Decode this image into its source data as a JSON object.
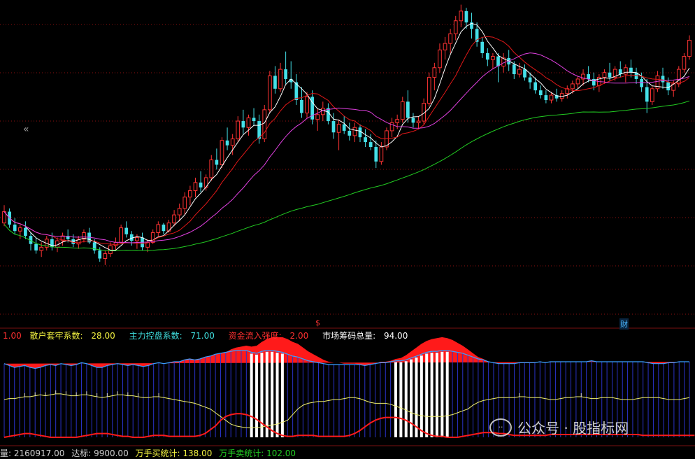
{
  "colors": {
    "up": "#ff3333",
    "down": "#44e0e8",
    "ma_white": "#ffffff",
    "ma_red": "#e01818",
    "ma_magenta": "#e040e0",
    "ma_green": "#22cc22",
    "blue_bar": "#2a33c8",
    "blue_line": "#3aa0ff",
    "yellow_line": "#f0f070",
    "red_line": "#ff1a1a",
    "grid": "#8b1010",
    "legend_white": "#ffffff",
    "legend_yellow": "#f0f040",
    "legend_cyan": "#40e0e0",
    "legend_red": "#ff3030"
  },
  "legend": {
    "first_value": "1.00",
    "item1_label": "散户套牢系数:",
    "item1_value": "28.00",
    "item2_label": "主力控盘系数:",
    "item2_value": "71.00",
    "item3_label": "资金流入强度:",
    "item3_value": "2.00",
    "item4_label": "市场筹码总量:",
    "item4_value": "94.00"
  },
  "footer": {
    "item1": "量: 2160917.00",
    "item2": "达标: 9900.00",
    "item3": "万手买统计: 138.00",
    "item4": "万手卖统计: 102.00"
  },
  "markers": {
    "s_marker": "$",
    "cai_marker": "财"
  },
  "nav": {
    "collapse_icon": "chevrons-left-icon",
    "collapse_glyph": "«"
  },
  "watermark": {
    "icon": "wechat-icon",
    "text": "公众号 · 股指标网"
  },
  "chart_data": [
    {
      "type": "candlestick",
      "ohlc": [
        [
          1.05,
          1.16,
          1.03,
          1.12
        ],
        [
          1.12,
          1.14,
          1.02,
          1.04
        ],
        [
          1.04,
          1.08,
          0.98,
          1.0
        ],
        [
          1.0,
          1.04,
          0.95,
          1.02
        ],
        [
          1.02,
          1.06,
          0.95,
          0.97
        ],
        [
          0.97,
          0.99,
          0.88,
          0.92
        ],
        [
          0.92,
          0.96,
          0.86,
          0.88
        ],
        [
          0.88,
          0.93,
          0.84,
          0.9
        ],
        [
          0.9,
          0.97,
          0.88,
          0.95
        ],
        [
          0.95,
          0.99,
          0.88,
          0.9
        ],
        [
          0.9,
          0.96,
          0.87,
          0.94
        ],
        [
          0.94,
          0.99,
          0.91,
          0.97
        ],
        [
          0.97,
          1.01,
          0.93,
          0.95
        ],
        [
          0.95,
          0.98,
          0.9,
          0.92
        ],
        [
          0.92,
          0.97,
          0.89,
          0.95
        ],
        [
          0.95,
          1.01,
          0.93,
          0.99
        ],
        [
          0.99,
          1.02,
          0.92,
          0.93
        ],
        [
          0.93,
          0.95,
          0.86,
          0.88
        ],
        [
          0.88,
          0.9,
          0.81,
          0.83
        ],
        [
          0.83,
          0.88,
          0.79,
          0.86
        ],
        [
          0.86,
          0.93,
          0.84,
          0.91
        ],
        [
          0.91,
          0.96,
          0.88,
          0.93
        ],
        [
          0.93,
          1.04,
          0.92,
          1.02
        ],
        [
          1.02,
          1.06,
          0.96,
          0.98
        ],
        [
          0.98,
          1.0,
          0.91,
          0.94
        ],
        [
          0.94,
          0.98,
          0.89,
          0.96
        ],
        [
          0.96,
          0.99,
          0.88,
          0.9
        ],
        [
          0.9,
          0.95,
          0.87,
          0.93
        ],
        [
          0.93,
          1.01,
          0.92,
          0.99
        ],
        [
          0.99,
          1.06,
          0.97,
          1.04
        ],
        [
          1.04,
          1.05,
          0.98,
          1.0
        ],
        [
          1.0,
          1.07,
          0.99,
          1.05
        ],
        [
          1.05,
          1.13,
          1.03,
          1.1
        ],
        [
          1.1,
          1.17,
          1.06,
          1.14
        ],
        [
          1.14,
          1.24,
          1.1,
          1.21
        ],
        [
          1.21,
          1.28,
          1.16,
          1.25
        ],
        [
          1.25,
          1.33,
          1.21,
          1.3
        ],
        [
          1.3,
          1.37,
          1.24,
          1.27
        ],
        [
          1.27,
          1.35,
          1.25,
          1.33
        ],
        [
          1.33,
          1.47,
          1.31,
          1.44
        ],
        [
          1.44,
          1.51,
          1.38,
          1.41
        ],
        [
          1.41,
          1.58,
          1.39,
          1.56
        ],
        [
          1.56,
          1.64,
          1.5,
          1.53
        ],
        [
          1.53,
          1.6,
          1.47,
          1.57
        ],
        [
          1.57,
          1.71,
          1.55,
          1.68
        ],
        [
          1.68,
          1.75,
          1.6,
          1.64
        ],
        [
          1.64,
          1.72,
          1.59,
          1.7
        ],
        [
          1.7,
          1.76,
          1.65,
          1.68
        ],
        [
          1.68,
          1.72,
          1.54,
          1.57
        ],
        [
          1.57,
          1.78,
          1.55,
          1.75
        ],
        [
          1.75,
          1.99,
          1.73,
          1.96
        ],
        [
          1.96,
          2.02,
          1.85,
          1.88
        ],
        [
          1.88,
          2.04,
          1.86,
          2.0
        ],
        [
          2.0,
          2.11,
          1.91,
          1.94
        ],
        [
          1.94,
          2.05,
          1.88,
          1.92
        ],
        [
          1.92,
          1.97,
          1.78,
          1.81
        ],
        [
          1.81,
          1.89,
          1.7,
          1.73
        ],
        [
          1.73,
          1.86,
          1.7,
          1.83
        ],
        [
          1.83,
          1.87,
          1.66,
          1.69
        ],
        [
          1.69,
          1.76,
          1.62,
          1.72
        ],
        [
          1.72,
          1.8,
          1.68,
          1.76
        ],
        [
          1.76,
          1.79,
          1.66,
          1.68
        ],
        [
          1.68,
          1.73,
          1.57,
          1.61
        ],
        [
          1.61,
          1.69,
          1.5,
          1.66
        ],
        [
          1.66,
          1.71,
          1.6,
          1.62
        ],
        [
          1.62,
          1.67,
          1.56,
          1.59
        ],
        [
          1.59,
          1.67,
          1.55,
          1.64
        ],
        [
          1.64,
          1.66,
          1.55,
          1.58
        ],
        [
          1.58,
          1.63,
          1.52,
          1.55
        ],
        [
          1.55,
          1.6,
          1.5,
          1.52
        ],
        [
          1.52,
          1.56,
          1.39,
          1.43
        ],
        [
          1.43,
          1.55,
          1.41,
          1.52
        ],
        [
          1.52,
          1.64,
          1.5,
          1.62
        ],
        [
          1.62,
          1.7,
          1.58,
          1.67
        ],
        [
          1.67,
          1.72,
          1.63,
          1.69
        ],
        [
          1.69,
          1.83,
          1.67,
          1.8
        ],
        [
          1.8,
          1.87,
          1.67,
          1.7
        ],
        [
          1.7,
          1.73,
          1.64,
          1.67
        ],
        [
          1.67,
          1.71,
          1.63,
          1.68
        ],
        [
          1.68,
          1.82,
          1.66,
          1.79
        ],
        [
          1.79,
          1.98,
          1.77,
          1.95
        ],
        [
          1.95,
          2.04,
          1.87,
          2.01
        ],
        [
          2.01,
          2.16,
          1.98,
          2.12
        ],
        [
          2.12,
          2.2,
          2.06,
          2.16
        ],
        [
          2.16,
          2.25,
          2.1,
          2.22
        ],
        [
          2.22,
          2.33,
          2.18,
          2.3
        ],
        [
          2.3,
          2.4,
          2.26,
          2.36
        ],
        [
          2.36,
          2.38,
          2.25,
          2.29
        ],
        [
          2.29,
          2.35,
          2.19,
          2.25
        ],
        [
          2.25,
          2.29,
          2.14,
          2.17
        ],
        [
          2.17,
          2.2,
          2.07,
          2.1
        ],
        [
          2.1,
          2.13,
          2.02,
          2.06
        ],
        [
          2.06,
          2.1,
          2.0,
          2.08
        ],
        [
          2.08,
          2.1,
          1.92,
          2.02
        ],
        [
          2.02,
          2.1,
          1.98,
          2.07
        ],
        [
          2.07,
          2.12,
          1.99,
          2.03
        ],
        [
          2.03,
          2.05,
          1.94,
          1.97
        ],
        [
          1.97,
          2.04,
          1.95,
          2.0
        ],
        [
          2.0,
          2.03,
          1.93,
          1.95
        ],
        [
          1.95,
          1.98,
          1.88,
          1.92
        ],
        [
          1.92,
          1.95,
          1.85,
          1.87
        ],
        [
          1.87,
          1.9,
          1.82,
          1.84
        ],
        [
          1.84,
          1.87,
          1.79,
          1.81
        ],
        [
          1.81,
          1.86,
          1.79,
          1.84
        ],
        [
          1.84,
          1.88,
          1.8,
          1.82
        ],
        [
          1.82,
          1.87,
          1.8,
          1.85
        ],
        [
          1.85,
          1.9,
          1.82,
          1.88
        ],
        [
          1.88,
          1.93,
          1.85,
          1.91
        ],
        [
          1.91,
          1.96,
          1.88,
          1.94
        ],
        [
          1.94,
          2.0,
          1.9,
          1.97
        ],
        [
          1.97,
          2.02,
          1.92,
          1.94
        ],
        [
          1.94,
          1.98,
          1.87,
          1.9
        ],
        [
          1.9,
          1.97,
          1.86,
          1.95
        ],
        [
          1.95,
          2.0,
          1.91,
          1.98
        ],
        [
          1.98,
          2.04,
          1.93,
          1.95
        ],
        [
          1.95,
          2.02,
          1.93,
          2.0
        ],
        [
          2.0,
          2.05,
          1.95,
          1.97
        ],
        [
          1.97,
          2.03,
          1.92,
          2.01
        ],
        [
          2.01,
          2.06,
          1.95,
          1.98
        ],
        [
          1.98,
          2.01,
          1.91,
          1.94
        ],
        [
          1.94,
          1.98,
          1.86,
          1.89
        ],
        [
          1.89,
          1.94,
          1.73,
          1.8
        ],
        [
          1.8,
          1.9,
          1.78,
          1.88
        ],
        [
          1.88,
          1.99,
          1.86,
          1.96
        ],
        [
          1.96,
          2.01,
          1.88,
          1.92
        ],
        [
          1.92,
          1.95,
          1.84,
          1.87
        ],
        [
          1.87,
          1.93,
          1.83,
          1.91
        ],
        [
          1.91,
          2.02,
          1.89,
          2.0
        ],
        [
          2.0,
          2.1,
          1.98,
          2.08
        ],
        [
          2.08,
          2.21,
          2.06,
          2.18
        ]
      ],
      "moving_average_periods": [
        5,
        10,
        20,
        60
      ],
      "moving_average_colors": [
        "#ffffff",
        "#e01818",
        "#e040e0",
        "#22cc22"
      ],
      "ylim": [
        0.75,
        2.42
      ],
      "grid": true
    },
    {
      "type": "bar",
      "blue_bars": [
        0.78,
        0.76,
        0.74,
        0.75,
        0.76,
        0.74,
        0.73,
        0.74,
        0.76,
        0.77,
        0.76,
        0.78,
        0.77,
        0.76,
        0.77,
        0.79,
        0.78,
        0.76,
        0.74,
        0.74,
        0.76,
        0.77,
        0.78,
        0.77,
        0.76,
        0.77,
        0.76,
        0.75,
        0.76,
        0.78,
        0.79,
        0.78,
        0.79,
        0.8,
        0.8,
        0.82,
        0.83,
        0.82,
        0.83,
        0.85,
        0.86,
        0.88,
        0.89,
        0.9,
        0.91,
        0.92,
        0.92,
        0.92,
        0.9,
        0.89,
        0.91,
        0.92,
        0.92,
        0.91,
        0.9,
        0.88,
        0.86,
        0.85,
        0.83,
        0.81,
        0.8,
        0.79,
        0.78,
        0.77,
        0.77,
        0.77,
        0.77,
        0.77,
        0.77,
        0.77,
        0.76,
        0.77,
        0.78,
        0.79,
        0.79,
        0.8,
        0.81,
        0.81,
        0.82,
        0.84,
        0.86,
        0.88,
        0.9,
        0.91,
        0.91,
        0.92,
        0.92,
        0.91,
        0.9,
        0.89,
        0.87,
        0.85,
        0.83,
        0.82,
        0.8,
        0.79,
        0.78,
        0.78,
        0.78,
        0.78,
        0.79,
        0.79,
        0.79,
        0.79,
        0.8,
        0.79,
        0.8,
        0.8,
        0.8,
        0.8,
        0.8,
        0.8,
        0.8,
        0.8,
        0.81,
        0.8,
        0.8,
        0.8,
        0.8,
        0.8,
        0.8,
        0.8,
        0.8,
        0.8,
        0.8,
        0.79,
        0.78,
        0.78,
        0.78,
        0.79,
        0.79,
        0.8,
        0.8,
        0.8
      ],
      "red_area": [
        0,
        0,
        0,
        0,
        0,
        0,
        0,
        0,
        0,
        0,
        0,
        0,
        0,
        0,
        0,
        0,
        0,
        0,
        0,
        0,
        0,
        0,
        0,
        0,
        0,
        0,
        0,
        0,
        0,
        0,
        0,
        0,
        0,
        0,
        0,
        0,
        0,
        0,
        0,
        0,
        0,
        0,
        0,
        0,
        0.02,
        0.03,
        0.04,
        0.05,
        0.06,
        0.08,
        0.1,
        0.12,
        0.14,
        0.15,
        0.16,
        0.16,
        0.15,
        0.14,
        0.12,
        0.1,
        0.08,
        0.06,
        0.04,
        0.03,
        0.02,
        0.02,
        0.01,
        0.01,
        0.01,
        0,
        0,
        0,
        0,
        0.01,
        0.01,
        0.01,
        0.02,
        0.03,
        0.05,
        0.07,
        0.09,
        0.11,
        0.12,
        0.13,
        0.14,
        0.14,
        0.13,
        0.12,
        0.1,
        0.08,
        0.06,
        0.04,
        0.02,
        0.01,
        0,
        0,
        0,
        0,
        0,
        0,
        0,
        0,
        0,
        0,
        0,
        0,
        0,
        0,
        0,
        0,
        0,
        0,
        0,
        0,
        0,
        0,
        0,
        0,
        0,
        0,
        0,
        0,
        0,
        0,
        0,
        0,
        0,
        0,
        0,
        0,
        0,
        0,
        0
      ],
      "white_bar_ranges": [
        [
          48,
          54
        ],
        [
          76,
          86
        ]
      ],
      "yellow_line": [
        0.4,
        0.41,
        0.41,
        0.42,
        0.43,
        0.43,
        0.44,
        0.45,
        0.44,
        0.45,
        0.46,
        0.46,
        0.45,
        0.44,
        0.44,
        0.45,
        0.45,
        0.44,
        0.43,
        0.42,
        0.43,
        0.44,
        0.45,
        0.45,
        0.44,
        0.44,
        0.43,
        0.42,
        0.42,
        0.43,
        0.43,
        0.42,
        0.41,
        0.4,
        0.39,
        0.38,
        0.37,
        0.36,
        0.34,
        0.32,
        0.3,
        0.26,
        0.22,
        0.18,
        0.14,
        0.12,
        0.11,
        0.1,
        0.1,
        0.1,
        0.11,
        0.12,
        0.13,
        0.14,
        0.16,
        0.18,
        0.24,
        0.3,
        0.34,
        0.36,
        0.37,
        0.38,
        0.38,
        0.39,
        0.4,
        0.4,
        0.41,
        0.42,
        0.42,
        0.41,
        0.39,
        0.37,
        0.36,
        0.36,
        0.36,
        0.35,
        0.33,
        0.31,
        0.29,
        0.26,
        0.24,
        0.23,
        0.22,
        0.22,
        0.22,
        0.22,
        0.23,
        0.24,
        0.26,
        0.28,
        0.3,
        0.34,
        0.37,
        0.39,
        0.4,
        0.41,
        0.42,
        0.42,
        0.42,
        0.42,
        0.43,
        0.43,
        0.42,
        0.42,
        0.42,
        0.41,
        0.4,
        0.4,
        0.41,
        0.42,
        0.42,
        0.43,
        0.43,
        0.42,
        0.41,
        0.41,
        0.42,
        0.42,
        0.42,
        0.41,
        0.4,
        0.4,
        0.4,
        0.41,
        0.42,
        0.42,
        0.42,
        0.42,
        0.41,
        0.4,
        0.4,
        0.4,
        0.41,
        0.42
      ],
      "red_line": [
        0.0,
        0.01,
        0.02,
        0.03,
        0.04,
        0.04,
        0.03,
        0.02,
        0.01,
        0.0,
        0.0,
        0.0,
        0.0,
        0.0,
        0.0,
        0.01,
        0.02,
        0.03,
        0.04,
        0.04,
        0.04,
        0.03,
        0.02,
        0.01,
        0.01,
        0.0,
        0.0,
        0.0,
        0.01,
        0.02,
        0.02,
        0.02,
        0.01,
        0.01,
        0.01,
        0.01,
        0.01,
        0.01,
        0.02,
        0.04,
        0.08,
        0.12,
        0.18,
        0.22,
        0.24,
        0.25,
        0.25,
        0.24,
        0.22,
        0.19,
        0.15,
        0.11,
        0.07,
        0.04,
        0.02,
        0.01,
        0.01,
        0.02,
        0.02,
        0.02,
        0.02,
        0.01,
        0.01,
        0.01,
        0.01,
        0.01,
        0.01,
        0.02,
        0.04,
        0.07,
        0.11,
        0.15,
        0.18,
        0.2,
        0.21,
        0.21,
        0.21,
        0.2,
        0.18,
        0.15,
        0.11,
        0.07,
        0.04,
        0.02,
        0.01,
        0.01,
        0.0,
        0.0,
        0.0,
        0.01,
        0.02,
        0.03,
        0.04,
        0.05,
        0.05,
        0.05,
        0.04,
        0.04,
        0.03,
        0.02,
        0.02,
        0.02,
        0.02,
        0.02,
        0.02,
        0.02,
        0.03,
        0.03,
        0.03,
        0.03,
        0.03,
        0.03,
        0.03,
        0.03,
        0.03,
        0.03,
        0.03,
        0.03,
        0.03,
        0.03,
        0.03,
        0.03,
        0.03,
        0.03,
        0.02,
        0.02,
        0.02,
        0.02,
        0.02,
        0.02,
        0.02,
        0.02,
        0.02,
        0.02,
        0.02
      ],
      "ylim": [
        0,
        1
      ]
    }
  ]
}
